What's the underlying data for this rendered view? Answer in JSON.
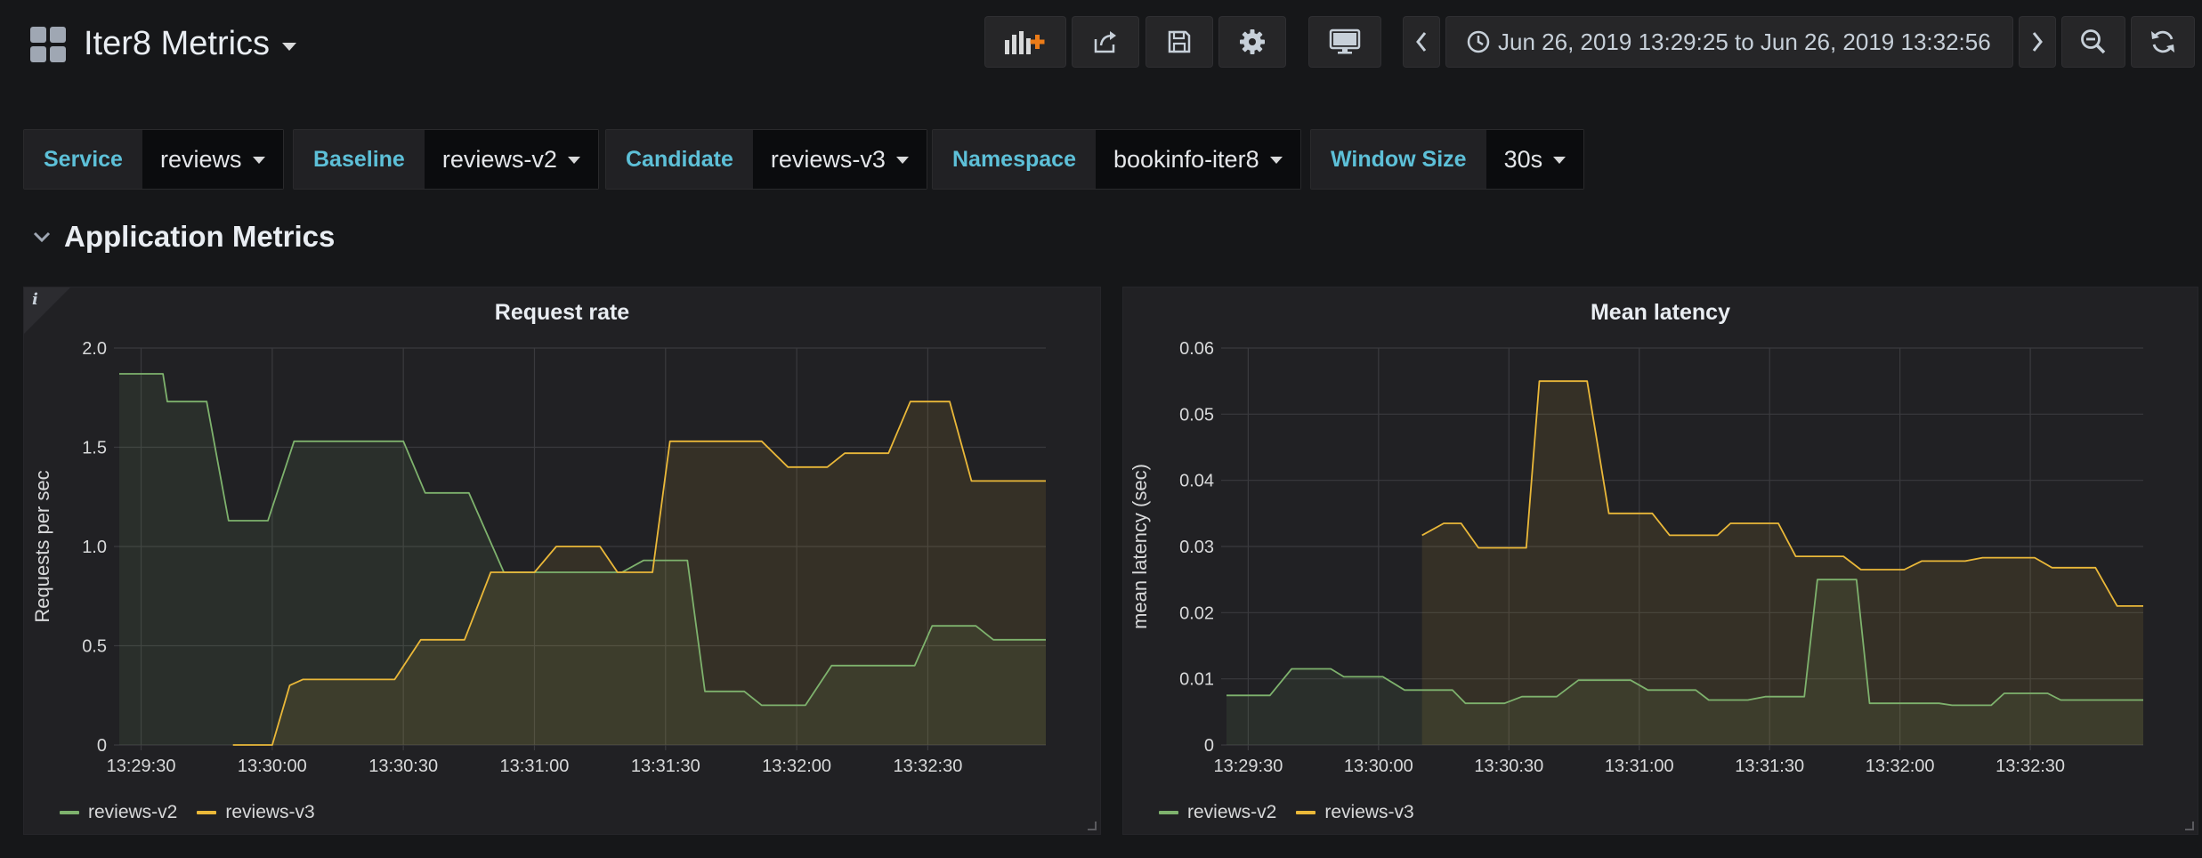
{
  "header": {
    "title": "Iter8 Metrics",
    "icons": [
      "add-panel-icon",
      "share-icon",
      "save-icon",
      "settings-icon",
      "tv-mode-icon",
      "chevron-left-icon",
      "clock-icon",
      "chevron-right-icon",
      "zoom-out-icon",
      "refresh-icon"
    ],
    "time_range": "Jun 26, 2019 13:29:25 to Jun 26, 2019 13:32:56"
  },
  "variables": [
    {
      "label": "Service",
      "value": "reviews"
    },
    {
      "label": "Baseline",
      "value": "reviews-v2"
    },
    {
      "label": "Candidate",
      "value": "reviews-v3"
    },
    {
      "label": "Namespace",
      "value": "bookinfo-iter8"
    },
    {
      "label": "Window Size",
      "value": "30s"
    }
  ],
  "row": {
    "title": "Application Metrics"
  },
  "panels": {
    "left": {
      "title": "Request rate",
      "info": "i"
    },
    "right": {
      "title": "Mean latency"
    }
  },
  "colors": {
    "v2": "#7eb26d",
    "v3": "#eab839",
    "accent": "#5dc0d8",
    "background": "#161719",
    "panel": "#212124"
  },
  "chart_data": [
    {
      "type": "area",
      "title": "Request rate",
      "xlabel": "",
      "ylabel": "Requests per sec",
      "ylim": [
        0,
        2.0
      ],
      "yticks": [
        "0",
        "0.5",
        "1.0",
        "1.5",
        "2.0"
      ],
      "xticks": [
        "13:29:30",
        "13:30:00",
        "13:30:30",
        "13:31:00",
        "13:31:30",
        "13:32:00",
        "13:32:30"
      ],
      "xlim": [
        "13:29:25",
        "13:32:57"
      ],
      "grid": true,
      "legend_position": "bottom-left",
      "series": [
        {
          "name": "reviews-v2",
          "color": "#7eb26d",
          "points": [
            [
              "13:29:25",
              1.87
            ],
            [
              "13:29:35",
              1.87
            ],
            [
              "13:29:36",
              1.73
            ],
            [
              "13:29:45",
              1.73
            ],
            [
              "13:29:50",
              1.13
            ],
            [
              "13:29:59",
              1.13
            ],
            [
              "13:30:05",
              1.53
            ],
            [
              "13:30:30",
              1.53
            ],
            [
              "13:30:35",
              1.27
            ],
            [
              "13:30:45",
              1.27
            ],
            [
              "13:30:53",
              0.87
            ],
            [
              "13:31:20",
              0.87
            ],
            [
              "13:31:25",
              0.93
            ],
            [
              "13:31:35",
              0.93
            ],
            [
              "13:31:39",
              0.27
            ],
            [
              "13:31:48",
              0.27
            ],
            [
              "13:31:52",
              0.2
            ],
            [
              "13:32:02",
              0.2
            ],
            [
              "13:32:08",
              0.4
            ],
            [
              "13:32:27",
              0.4
            ],
            [
              "13:32:31",
              0.6
            ],
            [
              "13:32:41",
              0.6
            ],
            [
              "13:32:45",
              0.53
            ],
            [
              "13:32:57",
              0.53
            ]
          ]
        },
        {
          "name": "reviews-v3",
          "color": "#eab839",
          "points": [
            [
              "13:29:51",
              0.0
            ],
            [
              "13:30:00",
              0.0
            ],
            [
              "13:30:04",
              0.3
            ],
            [
              "13:30:07",
              0.33
            ],
            [
              "13:30:28",
              0.33
            ],
            [
              "13:30:34",
              0.53
            ],
            [
              "13:30:44",
              0.53
            ],
            [
              "13:30:50",
              0.87
            ],
            [
              "13:31:00",
              0.87
            ],
            [
              "13:31:05",
              1.0
            ],
            [
              "13:31:15",
              1.0
            ],
            [
              "13:31:19",
              0.87
            ],
            [
              "13:31:27",
              0.87
            ],
            [
              "13:31:31",
              1.53
            ],
            [
              "13:31:52",
              1.53
            ],
            [
              "13:31:58",
              1.4
            ],
            [
              "13:32:07",
              1.4
            ],
            [
              "13:32:11",
              1.47
            ],
            [
              "13:32:21",
              1.47
            ],
            [
              "13:32:26",
              1.73
            ],
            [
              "13:32:35",
              1.73
            ],
            [
              "13:32:40",
              1.33
            ],
            [
              "13:32:57",
              1.33
            ]
          ]
        }
      ]
    },
    {
      "type": "area",
      "title": "Mean latency",
      "xlabel": "",
      "ylabel": "mean latency (sec)",
      "ylim": [
        0,
        0.06
      ],
      "yticks": [
        "0",
        "0.01",
        "0.02",
        "0.03",
        "0.04",
        "0.05",
        "0.06"
      ],
      "xticks": [
        "13:29:30",
        "13:30:00",
        "13:30:30",
        "13:31:00",
        "13:31:30",
        "13:32:00",
        "13:32:30"
      ],
      "xlim": [
        "13:29:25",
        "13:32:56"
      ],
      "grid": true,
      "legend_position": "bottom-left",
      "series": [
        {
          "name": "reviews-v2",
          "color": "#7eb26d",
          "points": [
            [
              "13:29:25",
              0.0075
            ],
            [
              "13:29:35",
              0.0075
            ],
            [
              "13:29:40",
              0.0115
            ],
            [
              "13:29:49",
              0.0115
            ],
            [
              "13:29:52",
              0.0103
            ],
            [
              "13:30:01",
              0.0103
            ],
            [
              "13:30:06",
              0.0083
            ],
            [
              "13:30:17",
              0.0083
            ],
            [
              "13:30:20",
              0.0063
            ],
            [
              "13:30:29",
              0.0063
            ],
            [
              "13:30:33",
              0.0073
            ],
            [
              "13:30:41",
              0.0073
            ],
            [
              "13:30:46",
              0.0098
            ],
            [
              "13:30:58",
              0.0098
            ],
            [
              "13:31:02",
              0.0083
            ],
            [
              "13:31:13",
              0.0083
            ],
            [
              "13:31:16",
              0.0068
            ],
            [
              "13:31:25",
              0.0068
            ],
            [
              "13:31:29",
              0.0073
            ],
            [
              "13:31:38",
              0.0073
            ],
            [
              "13:31:41",
              0.025
            ],
            [
              "13:31:50",
              0.025
            ],
            [
              "13:31:53",
              0.0063
            ],
            [
              "13:32:09",
              0.0063
            ],
            [
              "13:32:12",
              0.006
            ],
            [
              "13:32:21",
              0.006
            ],
            [
              "13:32:24",
              0.0078
            ],
            [
              "13:32:34",
              0.0078
            ],
            [
              "13:32:37",
              0.0068
            ],
            [
              "13:32:56",
              0.0068
            ]
          ]
        },
        {
          "name": "reviews-v3",
          "color": "#eab839",
          "points": [
            [
              "13:30:10",
              0.0317
            ],
            [
              "13:30:15",
              0.0335
            ],
            [
              "13:30:19",
              0.0335
            ],
            [
              "13:30:23",
              0.0298
            ],
            [
              "13:30:34",
              0.0298
            ],
            [
              "13:30:37",
              0.055
            ],
            [
              "13:30:48",
              0.055
            ],
            [
              "13:30:53",
              0.035
            ],
            [
              "13:31:03",
              0.035
            ],
            [
              "13:31:07",
              0.0317
            ],
            [
              "13:31:18",
              0.0317
            ],
            [
              "13:31:21",
              0.0335
            ],
            [
              "13:31:32",
              0.0335
            ],
            [
              "13:31:36",
              0.0285
            ],
            [
              "13:31:47",
              0.0285
            ],
            [
              "13:31:51",
              0.0265
            ],
            [
              "13:32:01",
              0.0265
            ],
            [
              "13:32:05",
              0.0278
            ],
            [
              "13:32:15",
              0.0278
            ],
            [
              "13:32:19",
              0.0283
            ],
            [
              "13:32:31",
              0.0283
            ],
            [
              "13:32:35",
              0.0268
            ],
            [
              "13:32:45",
              0.0268
            ],
            [
              "13:32:50",
              0.021
            ],
            [
              "13:32:56",
              0.021
            ]
          ]
        }
      ]
    }
  ]
}
